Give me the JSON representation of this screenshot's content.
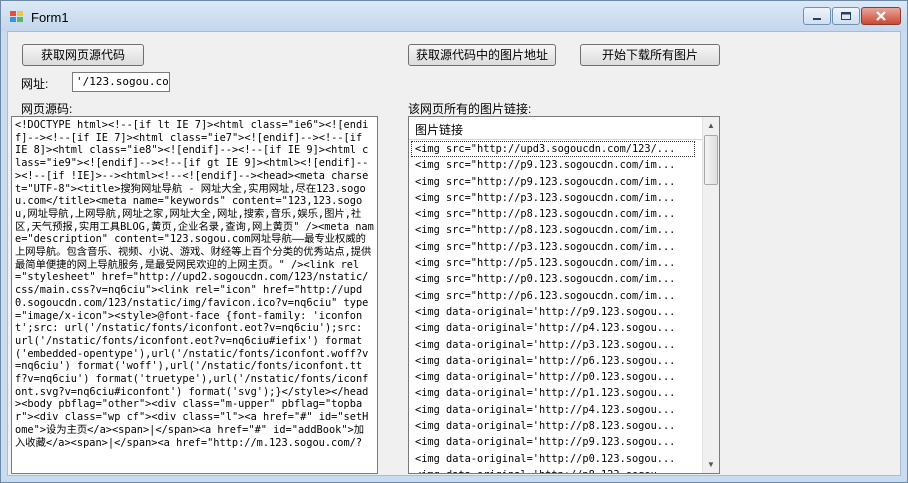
{
  "window": {
    "title": "Form1"
  },
  "buttons": {
    "get_source": "获取网页源代码",
    "get_image_urls": "获取源代码中的图片地址",
    "download_all": "开始下载所有图片"
  },
  "url": {
    "label": "网址:",
    "value": "'/123.sogou.com/"
  },
  "source": {
    "label": "网页源码:",
    "text": "<!DOCTYPE html><!--[if lt IE 7]><html class=\"ie6\"><![endif]--><!--[if IE 7]><html class=\"ie7\"><![endif]--><!--[if IE 8]><html class=\"ie8\"><![endif]--><!--[if IE 9]><html class=\"ie9\"><![endif]--><!--[if gt IE 9]><html><![endif]--><!--[if !IE]>--><html><!--<![endif]--><head><meta charset=\"UTF-8\"><title>搜狗网址导航 - 网址大全,实用网址,尽在123.sogou.com</title><meta name=\"keywords\" content=\"123,123.sogou,网址导航,上网导航,网址之家,网址大全,网址,搜索,音乐,娱乐,图片,社区,天气预报,实用工具BLOG,黄页,企业名录,查询,网上黄页\" /><meta name=\"description\" content=\"123.sogou.com网址导航——最专业权威的上网导航。包含音乐、视频、小说、游戏、财经等上百个分类的优秀站点,提供最简单便捷的网上导航服务,是最受网民欢迎的上网主页。\" /><link rel=\"stylesheet\" href=\"http://upd2.sogoucdn.com/123/nstatic/css/main.css?v=nq6ciu\"><link rel=\"icon\" href=\"http://upd0.sogoucdn.com/123/nstatic/img/favicon.ico?v=nq6ciu\" type=\"image/x-icon\"><style>@font-face {font-family: 'iconfont';src: url('/nstatic/fonts/iconfont.eot?v=nq6ciu');src: url('/nstatic/fonts/iconfont.eot?v=nq6ciu#iefix') format('embedded-opentype'),url('/nstatic/fonts/iconfont.woff?v=nq6ciu') format('woff'),url('/nstatic/fonts/iconfont.ttf?v=nq6ciu') format('truetype'),url('/nstatic/fonts/iconfont.svg?v=nq6ciu#iconfont') format('svg');}</style></head><body pbflag=\"other\"><div class=\"m-upper\" pbflag=\"topbar\"><div class=\"wp cf\"><div class=\"l\"><a href=\"#\" id=\"setHome\">设为主页</a><span>|</span><a href=\"#\" id=\"addBook\">加入收藏</a><span>|</span><a href=\"http://m.123.sogou.com/?"
  },
  "images": {
    "label": "该网页所有的图片链接:",
    "column_header": "图片链接",
    "rows": [
      "<img src=\"http://upd3.sogoucdn.com/123/...",
      "<img src=\"http://p9.123.sogoucdn.com/im...",
      "<img src=\"http://p9.123.sogoucdn.com/im...",
      "<img src=\"http://p3.123.sogoucdn.com/im...",
      "<img src=\"http://p8.123.sogoucdn.com/im...",
      "<img src=\"http://p8.123.sogoucdn.com/im...",
      "<img src=\"http://p3.123.sogoucdn.com/im...",
      "<img src=\"http://p5.123.sogoucdn.com/im...",
      "<img src=\"http://p0.123.sogoucdn.com/im...",
      "<img src=\"http://p6.123.sogoucdn.com/im...",
      "<img data-original='http://p9.123.sogou...",
      "<img data-original='http://p4.123.sogou...",
      "<img data-original='http://p3.123.sogou...",
      "<img data-original='http://p6.123.sogou...",
      "<img data-original='http://p0.123.sogou...",
      "<img data-original='http://p1.123.sogou...",
      "<img data-original='http://p4.123.sogou...",
      "<img data-original='http://p8.123.sogou...",
      "<img data-original='http://p9.123.sogou...",
      "<img data-original='http://p0.123.sogou...",
      "<img data-original='http://p8.123.sogou..."
    ]
  },
  "colors": {
    "window_frame": "#c9dbee",
    "client_bg": "#f0f0f0",
    "close_button": "#c94a35"
  },
  "icons": [
    "app-icon",
    "minimize-icon",
    "maximize-icon",
    "close-icon",
    "scroll-up-icon",
    "scroll-down-icon"
  ]
}
